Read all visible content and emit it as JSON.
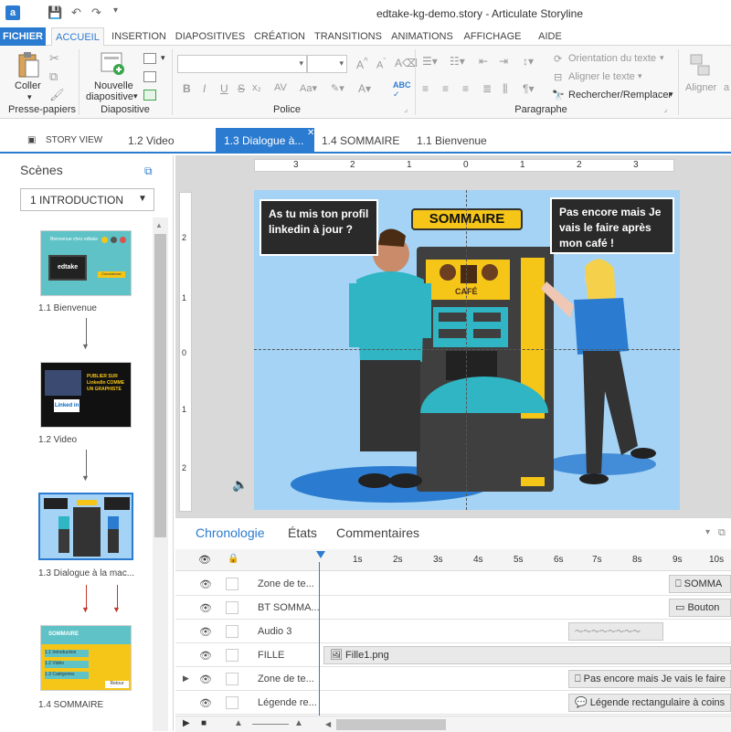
{
  "window": {
    "title": "edtake-kg-demo.story - Articulate Storyline"
  },
  "ribbon_tabs": [
    "FICHIER",
    "ACCUEIL",
    "INSERTION",
    "DIAPOSITIVES",
    "CRÉATION",
    "TRANSITIONS",
    "ANIMATIONS",
    "AFFICHAGE",
    "AIDE"
  ],
  "ribbon": {
    "coller": "Coller",
    "presse_papiers": "Presse-papiers",
    "nouvelle_line1": "Nouvelle",
    "nouvelle_line2": "diapositive",
    "diapositive": "Diapositive",
    "police": "Police",
    "paragraphe": "Paragraphe",
    "orientation": "Orientation du texte",
    "aligner_texte": "Aligner le texte",
    "rechercher": "Rechercher/Remplacer",
    "aligner": "Aligner"
  },
  "view_tabs": [
    "STORY VIEW",
    "1.2 Video",
    "1.3 Dialogue à...",
    "1.4 SOMMAIRE",
    "1.1 Bienvenue"
  ],
  "scenes": {
    "title": "Scènes",
    "selected": "1 INTRODUCTION",
    "items": [
      {
        "label": "1.1 Bienvenue",
        "thumb_text": "Bienvenue chez edtake",
        "logo": "edtake",
        "button": "Commencer"
      },
      {
        "label": "1.2 Video",
        "thumb_title": "PUBLIER SUR LinkedIn COMME UN GRAPHISTE"
      },
      {
        "label": "1.3 Dialogue à la mac..."
      },
      {
        "label": "1.4 SOMMAIRE",
        "thumb_title": "SOMMAIRE",
        "thumb_items": [
          "1.1 Introduction",
          "1.2 Vidéo",
          "1.3 Catégories"
        ],
        "thumb_button": "Retour"
      }
    ]
  },
  "slide": {
    "left_bubble": "As tu mis ton profil linkedin à jour ?",
    "right_bubble": "Pas encore mais Je vais le faire après mon café !",
    "sommaire": "SOMMAIRE",
    "cafe": "CAFÉ"
  },
  "ruler": {
    "top": [
      "3",
      "2",
      "1",
      "0",
      "1",
      "2",
      "3"
    ],
    "left": [
      "2",
      "1",
      "0",
      "1",
      "2"
    ]
  },
  "timeline": {
    "tabs": [
      "Chronologie",
      "États",
      "Commentaires"
    ],
    "seconds": [
      "1s",
      "2s",
      "3s",
      "4s",
      "5s",
      "6s",
      "7s",
      "8s",
      "9s",
      "10s"
    ],
    "rows": [
      {
        "name": "Zone de te...",
        "bar": "SOMMA"
      },
      {
        "name": "BT SOMMA...",
        "bar": "Bouton"
      },
      {
        "name": "Audio 3",
        "bar": ""
      },
      {
        "name": "FILLE",
        "bar": "Fille1.png"
      },
      {
        "name": "Zone de te...",
        "bar": "Pas encore mais Je vais le faire"
      },
      {
        "name": "Légende re...",
        "bar": "Légende rectangulaire à coins"
      }
    ]
  },
  "colors": {
    "accent": "#2b7bd0",
    "slide_bg": "#a4d3f5",
    "yellow": "#f5c518"
  }
}
